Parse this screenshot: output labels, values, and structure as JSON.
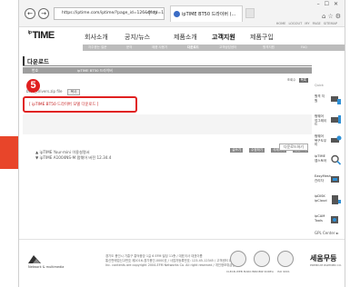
{
  "browser": {
    "address": "https://iptime.com/iptime/?page_id=126&dfsid=13&uid=...",
    "tab_title": "ipTIME BT50 드라이버 (...",
    "back_icon": "back-arrow-icon",
    "forward_icon": "forward-arrow-icon"
  },
  "header": {
    "top_links": "HOME  LOGOUT  MY PAGE  SITEMAP",
    "logo_small": "ip",
    "logo": "TIME",
    "gnb": [
      "회사소개",
      "공지/뉴스",
      "제품소개",
      "고객지원",
      "제품구입"
    ],
    "gnb_active": "고객지원",
    "subnav": [
      "자주묻는 질문",
      "문의",
      "제품 사용기",
      "다운로드",
      "고객상담센터",
      "원격지원",
      "FAQ"
    ],
    "subnav_active": "다운로드"
  },
  "main": {
    "page_title": "다운로드",
    "board_cols": [
      "번호",
      "ipTIME BT50 드라이버"
    ],
    "row_meta": "조회수",
    "row_btn": "목록",
    "file_name": "bt50_drivers.zip  file",
    "file_btn": "복사",
    "highlight_text": "[ ipTIME BT50 드라이버 모델 다운로드 ]",
    "step_number": "5",
    "actions": [
      "글쓰기",
      "수정하기",
      "삭제하기",
      "답글쓰기"
    ],
    "list_btn": "다운로드하기",
    "list_items": [
      "▲ ipTIME Your-mini 이용설명서",
      "▼ ipTIME A1004NS-M 펌웨어 버전 12.34.4"
    ]
  },
  "sidebar": {
    "top": "Quick",
    "items": [
      {
        "label": "원격 지원",
        "icon": "remote-support-icon"
      },
      {
        "label": "펌웨어 업그레이드",
        "icon": "firmware-upgrade-icon"
      },
      {
        "label": "펌웨어 복구도우미",
        "icon": "firmware-recovery-icon"
      },
      {
        "label": "ipTIME 앱스토어",
        "icon": "search-icon"
      },
      {
        "label": "EasyMesh 관리자",
        "icon": "easymesh-icon"
      },
      {
        "label": "ipDISK ipCloud",
        "icon": "ipdisk-icon"
      },
      {
        "label": "ipCAM Tools",
        "icon": "ipcam-icon"
      }
    ],
    "gpl": "GPL Center ►"
  },
  "footer": {
    "brand": "Network & multimedia",
    "info": [
      "경기도 용인시 기흥구 흥덕중앙 1길 6 EFM 빌딩 11층 / 대표이사 대표이름",
      "통신판매업신고번호 제2016-경기용인-0000호 / 사업자등록번호: 123-45-12345 / 고객센터 1544-8695",
      "Inc. contents are copyright 2004-EFM Networks Co. All right reserved / 개인정보취급방침"
    ],
    "certs": [
      "CLEAN WEB MARK",
      "INNOBIZ KOREA",
      "ISO 9001"
    ],
    "sejong": "세움무등",
    "sejong_sub": "PREMIUM PARTNER CO."
  },
  "colors": {
    "highlight": "#e02020",
    "arrow": "#e8452a",
    "subnav": "#bcbcbc"
  }
}
